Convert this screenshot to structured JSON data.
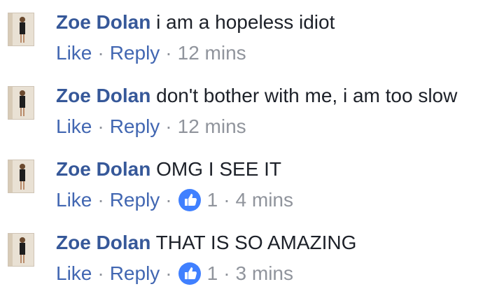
{
  "comments": [
    {
      "author": "Zoe Dolan",
      "text": "i am a hopeless idiot",
      "like_label": "Like",
      "reply_label": "Reply",
      "separator": "·",
      "time": "12 mins",
      "likes": ""
    },
    {
      "author": "Zoe Dolan",
      "text": "don't bother with me, i am too slow",
      "like_label": "Like",
      "reply_label": "Reply",
      "separator": "·",
      "time": "12 mins",
      "likes": ""
    },
    {
      "author": "Zoe Dolan",
      "text": "OMG I SEE IT",
      "like_label": "Like",
      "reply_label": "Reply",
      "separator": "·",
      "time": "4 mins",
      "likes": "1"
    },
    {
      "author": "Zoe Dolan",
      "text": "THAT IS SO AMAZING",
      "like_label": "Like",
      "reply_label": "Reply",
      "separator": "·",
      "time": "3 mins",
      "likes": "1"
    }
  ],
  "icons": {
    "like_badge": "thumbs-up-icon",
    "avatar": "avatar-photo"
  },
  "colors": {
    "author": "#365899",
    "action_link": "#4267b2",
    "meta": "#90949c",
    "text": "#1d2129",
    "like_badge": "#4080ff"
  }
}
